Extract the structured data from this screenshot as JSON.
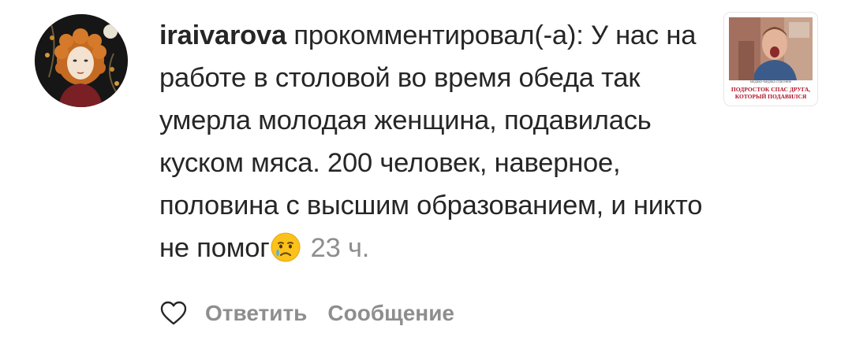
{
  "comment": {
    "username": "iraivarova",
    "action_text": " прокомментировал(-а): У нас на работе в столовой во время обеда так умерла молодая женщина, подавилась куском мяса. 200 человек, наверное, половина с высшим образованием, и никто не помог",
    "emoji": "crying-face",
    "time": "23 ч."
  },
  "actions": {
    "like_icon": "heart-outline-icon",
    "reply_label": "Ответить",
    "message_label": "Сообщение"
  },
  "thumbnail": {
    "small_caption": "медико-медика спасение",
    "caption_line1": "ПОДРОСТОК СПАС ДРУГА,",
    "caption_line2": "КОТОРЫЙ ПОДАВИЛСЯ"
  },
  "colors": {
    "text": "#262626",
    "secondary": "#8e8e8e",
    "caption_red": "#b0152a"
  }
}
